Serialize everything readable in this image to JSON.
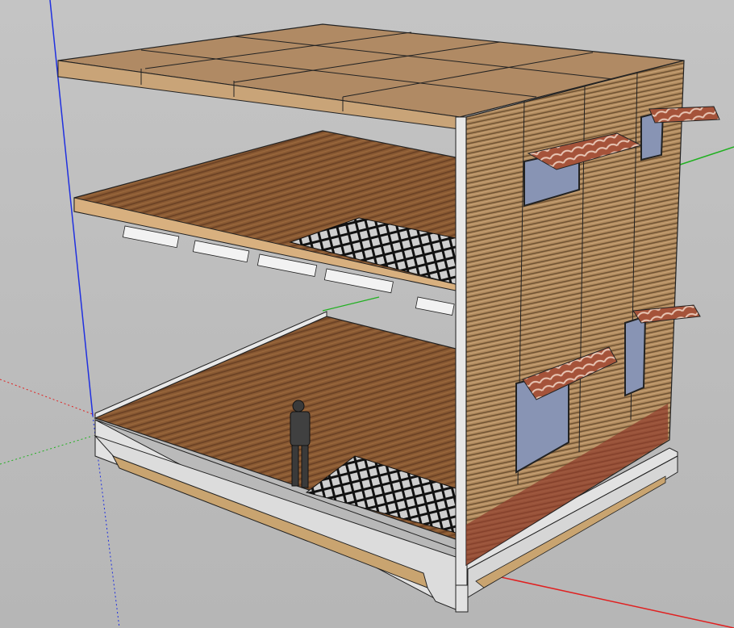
{
  "colors": {
    "background": "#bcbcbc",
    "axis_red": "#e02020",
    "axis_green": "#20b020",
    "axis_blue": "#2030e0",
    "wood_floor": "#8a5a33",
    "wood_floor_dark": "#6b4023",
    "roof_top": "#b08a64",
    "wall_wood": "#a8845a",
    "concrete": "#dcdcdc",
    "window_glass": "#8894b4",
    "tile": "#a5533a",
    "floor_grid": "#111111"
  },
  "scene": {
    "elements": [
      "red-axis",
      "green-axis",
      "blue-axis",
      "foundation",
      "ground-floor",
      "middle-floor",
      "roof-slab",
      "side-wall",
      "windows",
      "canopies",
      "floor-grids",
      "human-figure"
    ]
  }
}
